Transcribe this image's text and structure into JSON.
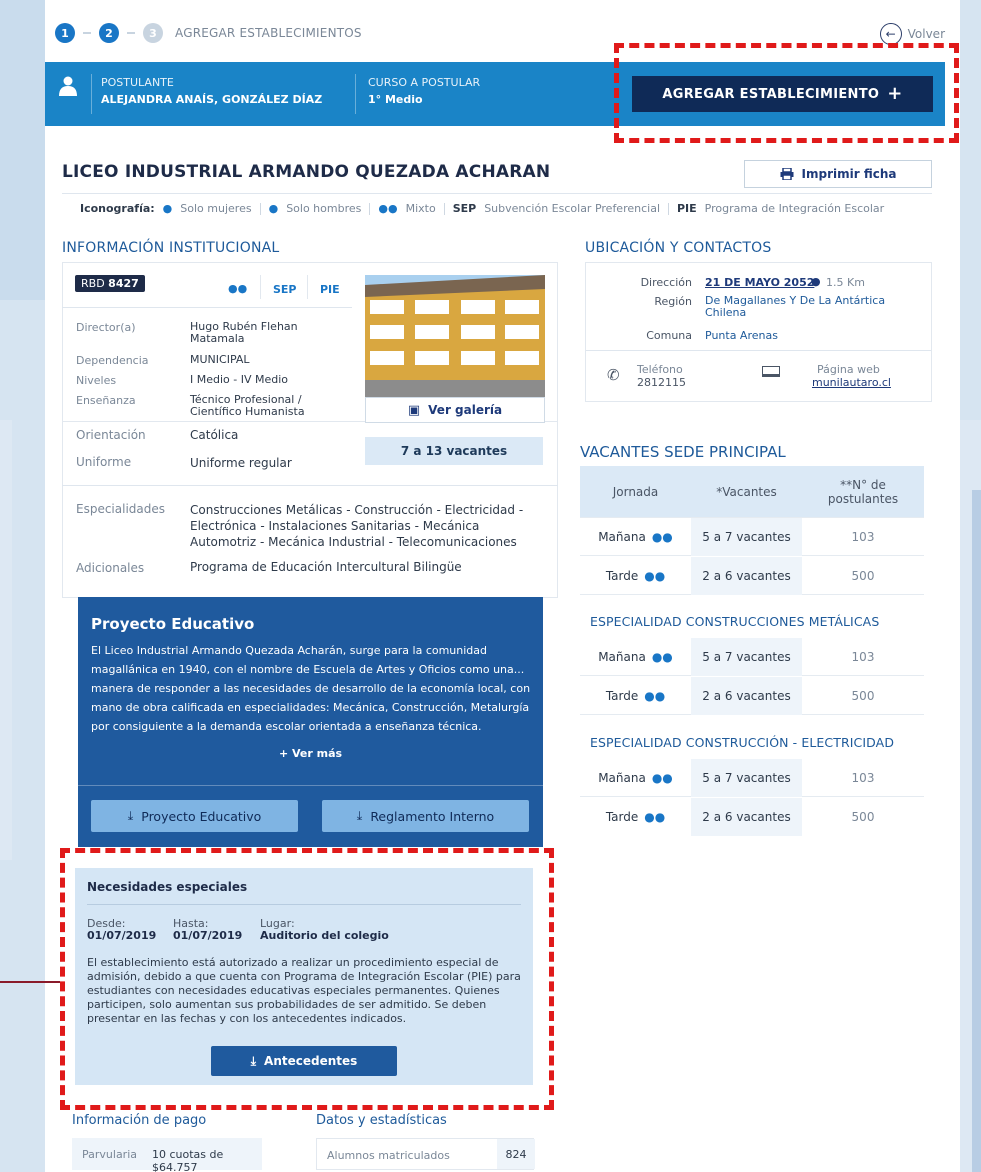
{
  "steps": {
    "items": [
      "1",
      "2",
      "3"
    ],
    "title": "AGREGAR ESTABLECIMIENTOS",
    "back": "Volver"
  },
  "banner": {
    "applicant_label": "POSTULANTE",
    "applicant_name": "ALEJANDRA ANAÍS, GONZÁLEZ DÍAZ",
    "course_label": "CURSO A POSTULAR",
    "course_value": "1° Medio",
    "add_button": "AGREGAR ESTABLECIMIENTO"
  },
  "school": {
    "name": "LICEO INDUSTRIAL ARMANDO QUEZADA ACHARAN",
    "print": "Imprimir ficha"
  },
  "iconography": {
    "label": "Iconografía:",
    "women": "Solo mujeres",
    "men": "Solo hombres",
    "mixed": "Mixto",
    "sep_code": "SEP",
    "sep_text": "Subvención Escolar Preferencial",
    "pie_code": "PIE",
    "pie_text": "Programa de Integración Escolar"
  },
  "institutional": {
    "heading": "INFORMACIÓN INSTITUCIONAL",
    "rbd_label": "RBD",
    "rbd_value": "8427",
    "badges": [
      "SEP",
      "PIE"
    ],
    "rows": [
      {
        "k": "Director(a)",
        "v": "Hugo Rubén Flehan Matamala"
      },
      {
        "k": "Dependencia",
        "v": "MUNICIPAL"
      },
      {
        "k": "Niveles",
        "v": "I Medio - IV Medio"
      },
      {
        "k": "Enseñanza",
        "v": "Técnico Profesional / Científico Humanista"
      },
      {
        "k": "Orientación",
        "v": "Católica"
      },
      {
        "k": "Uniforme",
        "v": "Uniforme regular"
      },
      {
        "k": "Especialidades",
        "v": "Construcciones Metálicas - Construcción - Electricidad - Electrónica - Instalaciones Sanitarias - Mecánica Automotriz - Mecánica Industrial - Telecomunicaciones"
      },
      {
        "k": "Adicionales",
        "v": "Programa de Educación Intercultural Bilingüe"
      }
    ],
    "gallery": "Ver galería",
    "vacancies": "7 a 13 vacantes"
  },
  "location": {
    "heading": "UBICACIÓN Y CONTACTOS",
    "address_k": "Dirección",
    "address_v": "21 DE MAYO 2052",
    "distance": "1.5 Km",
    "region_k": "Región",
    "region_v": "De Magallanes Y De La Antártica Chilena",
    "commune_k": "Comuna",
    "commune_v": "Punta Arenas",
    "phone_k": "Teléfono",
    "phone_v": "2812115",
    "web_k": "Página web",
    "web_v": "munilautaro.cl"
  },
  "vacancies": {
    "heading": "VACANTES SEDE PRINCIPAL",
    "headers": [
      "Jornada",
      "*Vacantes",
      "**N° de postulantes"
    ],
    "main": [
      {
        "j": "Mañana",
        "v": "5 a 7 vacantes",
        "n": "103"
      },
      {
        "j": "Tarde",
        "v": "2 a 6 vacantes",
        "n": "500"
      }
    ],
    "spec1_title": "ESPECIALIDAD CONSTRUCCIONES METÁLICAS",
    "spec1": [
      {
        "j": "Mañana",
        "v": "5 a 7 vacantes",
        "n": "103"
      },
      {
        "j": "Tarde",
        "v": "2 a 6 vacantes",
        "n": "500"
      }
    ],
    "spec2_title": "ESPECIALIDAD CONSTRUCCIÓN - ELECTRICIDAD",
    "spec2": [
      {
        "j": "Mañana",
        "v": "5 a 7 vacantes",
        "n": "103"
      },
      {
        "j": "Tarde",
        "v": "2 a 6 vacantes",
        "n": "500"
      }
    ]
  },
  "project": {
    "title": "Proyecto Educativo",
    "text": "El Liceo Industrial Armando Quezada Acharán, surge para la comunidad magallánica en 1940, con el nombre de Escuela de Artes y Oficios como una... manera de responder a las necesidades de desarrollo de la economía local, con mano de obra calificada en especialidades: Mecánica, Construcción, Metalurgía por consiguiente a la demanda escolar orientada a enseñanza técnica.",
    "more": "+ Ver más",
    "btn1": "Proyecto Educativo",
    "btn2": "Reglamento Interno"
  },
  "special": {
    "title": "Necesidades especiales",
    "from_k": "Desde:",
    "from_v": "01/07/2019",
    "to_k": "Hasta:",
    "to_v": "01/07/2019",
    "place_k": "Lugar:",
    "place_v": "Auditorio del colegio",
    "text": "El establecimiento está autorizado a realizar un procedimiento especial de admisión, debido a que cuenta con Programa de Integración Escolar (PIE) para estudiantes con necesidades educativas especiales permanentes. Quienes participen, solo aumentan sus probabilidades de ser admitido. Se deben presentar en las fechas y con los antecedentes indicados.",
    "button": "Antecedentes"
  },
  "payment": {
    "heading": "Información de pago",
    "row_k": "Parvularia",
    "row_v": "10 cuotas de $64.757"
  },
  "stats": {
    "heading": "Datos y estadísticas",
    "row_k": "Alumnos matriculados",
    "row_v": "824"
  },
  "colors": {
    "primary": "#1a84c7",
    "navy": "#0f2a57",
    "highlight": "#e01a1a"
  }
}
